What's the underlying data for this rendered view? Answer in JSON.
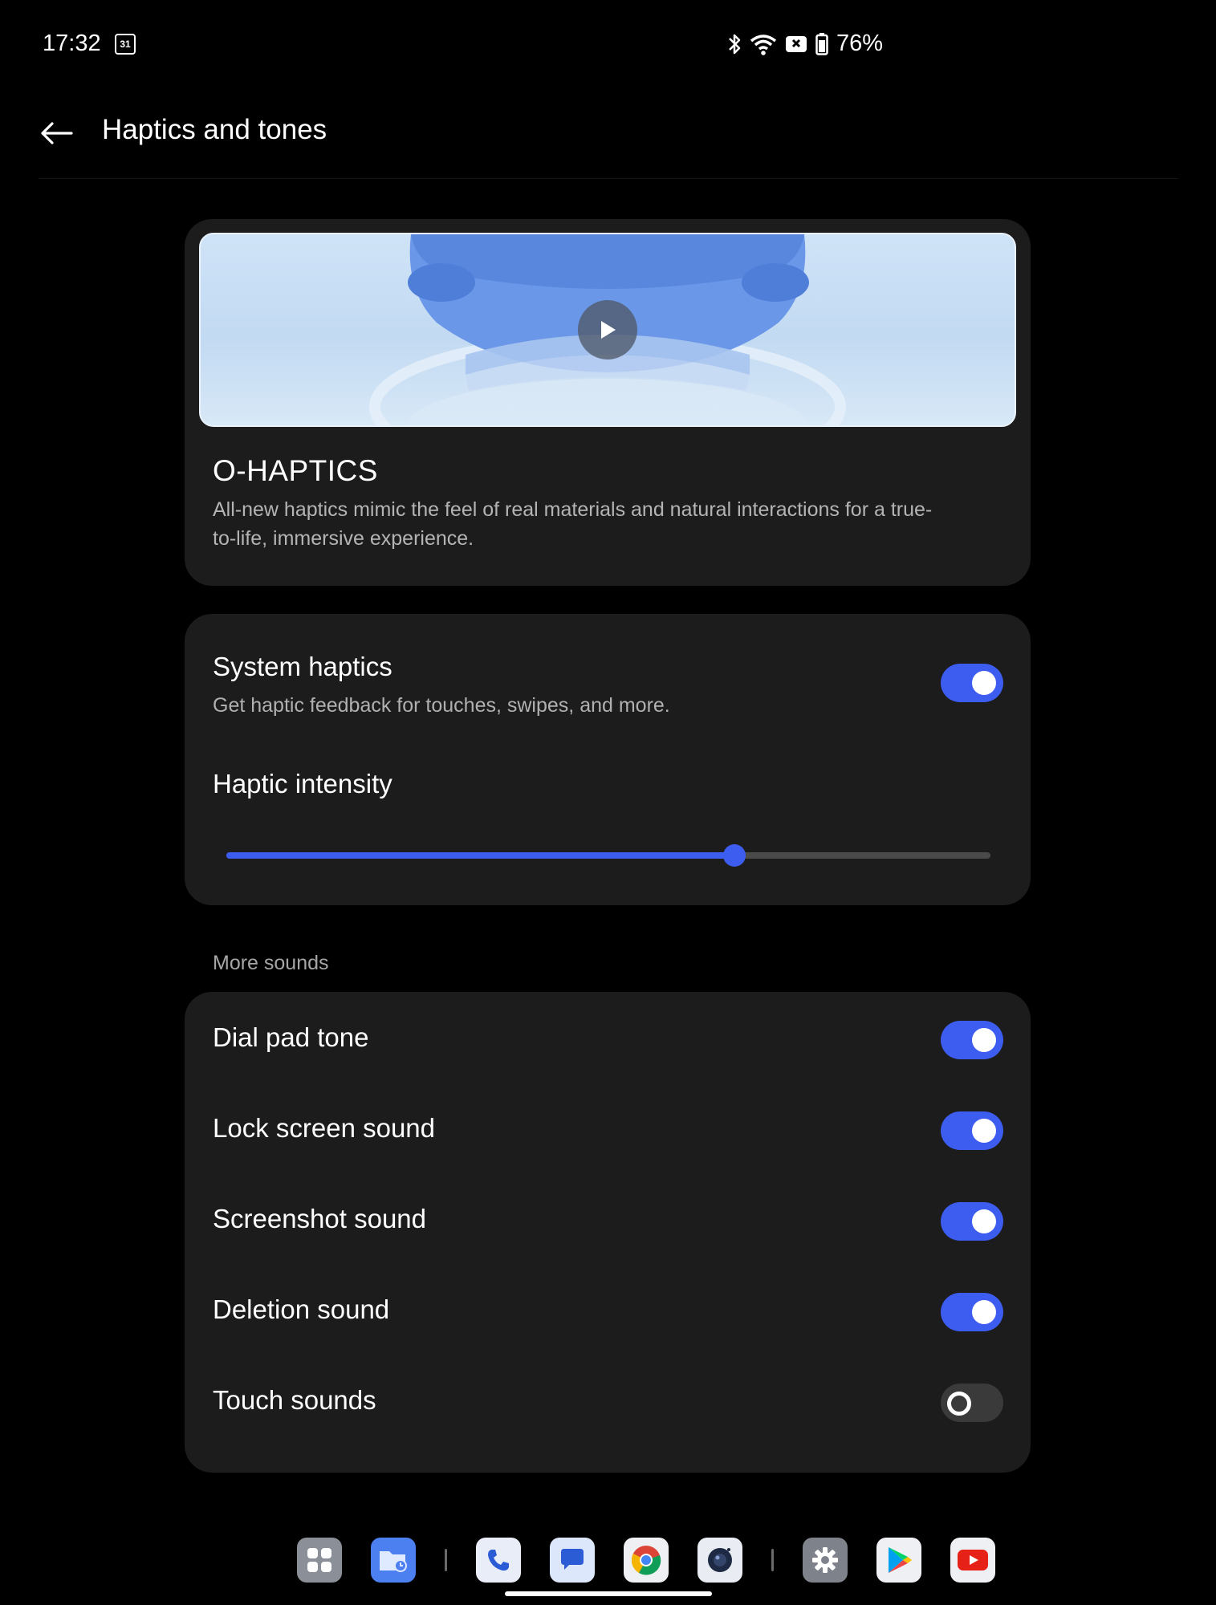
{
  "status_bar": {
    "time": "17:32",
    "calendar_day": "31",
    "battery": "76%",
    "icons": [
      "calendar-icon",
      "bluetooth-icon",
      "wifi-icon",
      "no-sim-icon",
      "battery-icon"
    ]
  },
  "header": {
    "title": "Haptics and tones"
  },
  "hero": {
    "title": "O-HAPTICS",
    "description": "All-new haptics mimic the feel of real materials and natural interactions for a true-to-life, immersive experience."
  },
  "system_haptics": {
    "title": "System haptics",
    "subtitle": "Get haptic feedback for touches, swipes, and more.",
    "enabled": true,
    "intensity_label": "Haptic intensity",
    "intensity_value": 0.665
  },
  "more_sounds": {
    "section_label": "More sounds",
    "items": [
      {
        "label": "Dial pad tone",
        "enabled": true
      },
      {
        "label": "Lock screen sound",
        "enabled": true
      },
      {
        "label": "Screenshot sound",
        "enabled": true
      },
      {
        "label": "Deletion sound",
        "enabled": true
      },
      {
        "label": "Touch sounds",
        "enabled": false
      }
    ]
  },
  "dock": {
    "apps": [
      "app-drawer-icon",
      "files-icon",
      "phone-icon",
      "messages-icon",
      "chrome-icon",
      "camera-icon",
      "settings-icon",
      "play-store-icon",
      "youtube-icon"
    ]
  },
  "colors": {
    "accent": "#3d5cf0",
    "card": "#1c1c1c",
    "background": "#000000"
  }
}
